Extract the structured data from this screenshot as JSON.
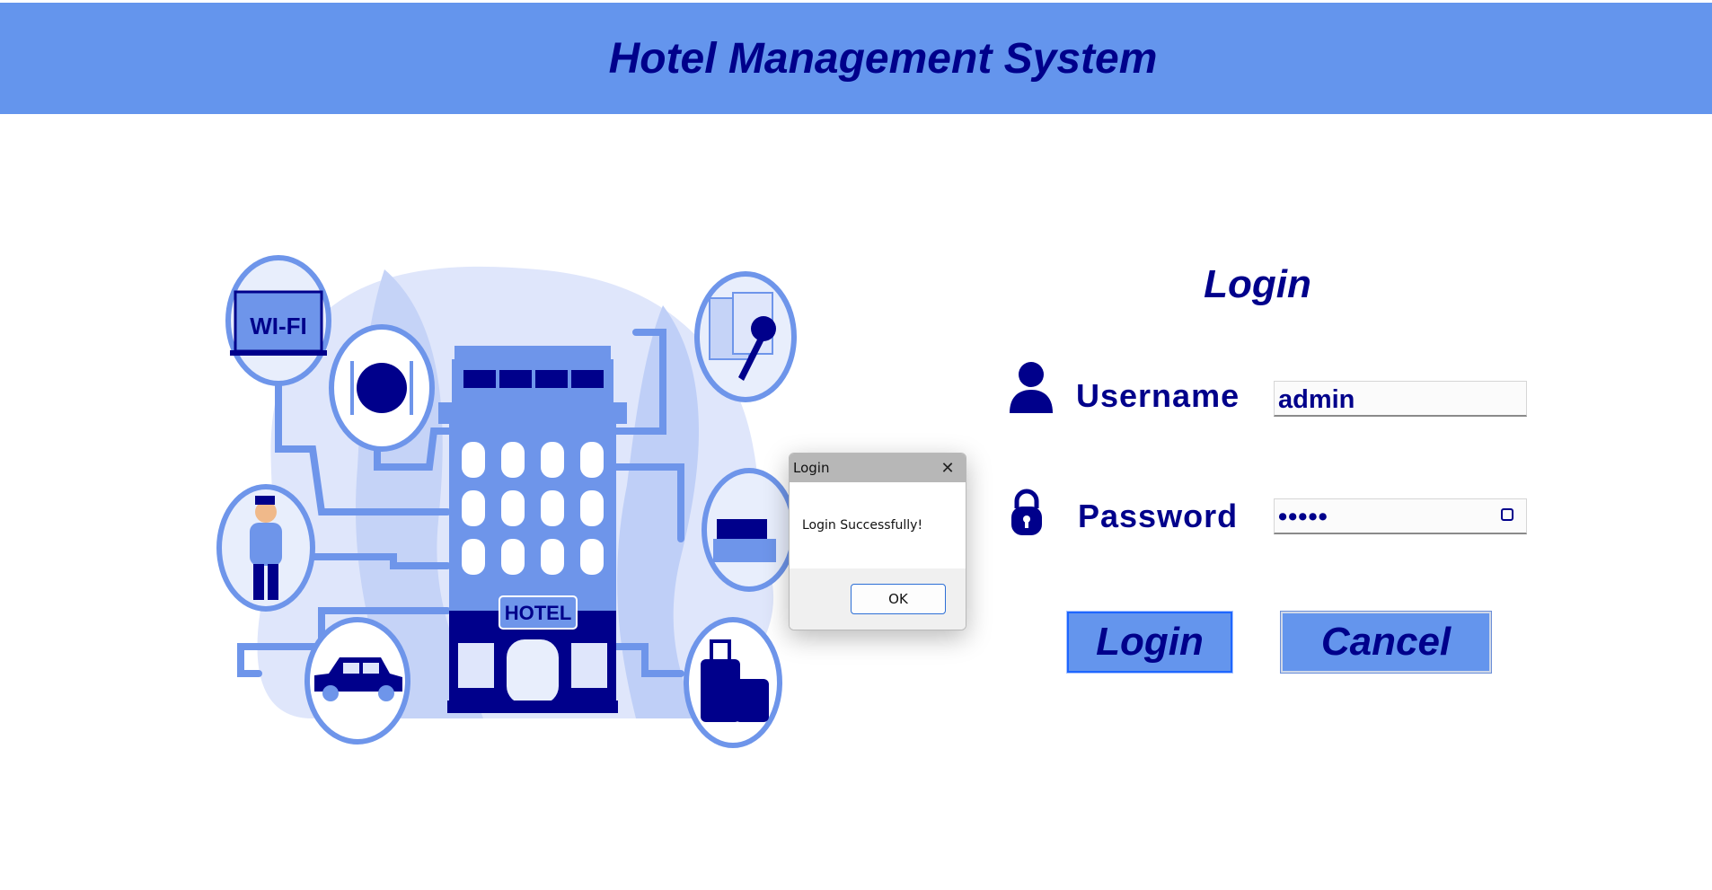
{
  "header": {
    "title": "Hotel Management System"
  },
  "illustration": {
    "sign_text": "HOTEL",
    "wifi_text": "WI-FI"
  },
  "login": {
    "title": "Login",
    "username_label": "Username",
    "username_value": "admin",
    "password_label": "Password",
    "password_value": "•••••",
    "login_button": "Login",
    "cancel_button": "Cancel"
  },
  "dialog": {
    "title": "Login",
    "message": "Login Successfully!",
    "ok_button": "OK"
  },
  "colors": {
    "header_bg": "#6495ed",
    "text": "#00008b",
    "button_bg": "#6495ed"
  },
  "icons": [
    "user-icon",
    "lock-icon",
    "password-reveal-icon",
    "close-icon"
  ]
}
